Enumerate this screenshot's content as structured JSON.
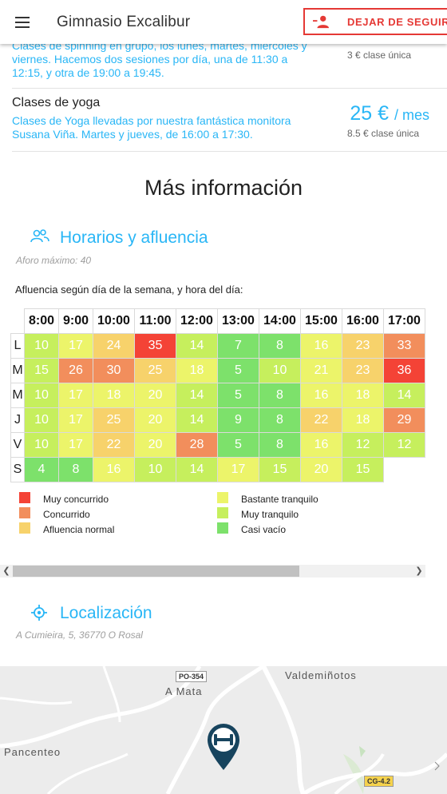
{
  "appbar": {
    "title": "Gimnasio Excalibur",
    "follow_label": "DEJAR DE SEGUIR"
  },
  "prices": [
    {
      "title": "",
      "desc": "Clases de spinning en grupo, los lunes, martes, miércoles y viernes. Hacemos dos sesiones por día, una de 11:30 a 12:15, y otra de 19:00 a 19:45.",
      "price": "",
      "unit": "",
      "single": "3 € clase única"
    },
    {
      "title": "Clases de yoga",
      "desc": "Clases de Yoga llevadas por nuestra fantástica monitora Susana Viña. Martes y jueves, de 16:00 a 17:30.",
      "price": "25 €",
      "unit": "/ mes",
      "single": "8.5 € clase única"
    }
  ],
  "more_info": "Más información",
  "schedule": {
    "title": "Horarios y afluencia",
    "capacity": "Aforo máximo: 40",
    "table_label": "Afluencia según día de la semana, y hora del día:",
    "hours": [
      "8:00",
      "9:00",
      "10:00",
      "11:00",
      "12:00",
      "13:00",
      "14:00",
      "15:00",
      "16:00",
      "17:00"
    ],
    "days": [
      {
        "day": "L",
        "values": [
          10,
          17,
          24,
          35,
          14,
          7,
          8,
          16,
          23,
          33
        ]
      },
      {
        "day": "M",
        "values": [
          15,
          26,
          30,
          25,
          18,
          5,
          10,
          21,
          23,
          36
        ]
      },
      {
        "day": "M",
        "values": [
          10,
          17,
          18,
          20,
          14,
          5,
          8,
          16,
          18,
          14
        ]
      },
      {
        "day": "J",
        "values": [
          10,
          17,
          25,
          20,
          14,
          9,
          8,
          22,
          18,
          29
        ]
      },
      {
        "day": "V",
        "values": [
          10,
          17,
          22,
          20,
          28,
          5,
          8,
          16,
          12,
          12
        ]
      },
      {
        "day": "S",
        "values": [
          4,
          8,
          16,
          10,
          14,
          17,
          15,
          20,
          15,
          null
        ]
      }
    ],
    "legend": [
      {
        "label": "Muy concurrido",
        "color": "#f44336"
      },
      {
        "label": "Concurrido",
        "color": "#f28e5c"
      },
      {
        "label": "Afluencia normal",
        "color": "#f7d26b"
      },
      {
        "label": "Bastante tranquilo",
        "color": "#ecf46a"
      },
      {
        "label": "Muy tranquilo",
        "color": "#c6ef5d"
      },
      {
        "label": "Casi vacío",
        "color": "#7de16b"
      }
    ]
  },
  "location": {
    "title": "Localización",
    "address": "A Cumieira, 5, 36770 O Rosal"
  },
  "map": {
    "places": [
      "Valdemiñotos",
      "A Mata",
      "Pancenteo"
    ],
    "roads": [
      "PO-354",
      "CG-4.2"
    ]
  },
  "colors": {
    "accent": "#29b6f6",
    "danger": "#e53935",
    "pin": "#17445e"
  }
}
